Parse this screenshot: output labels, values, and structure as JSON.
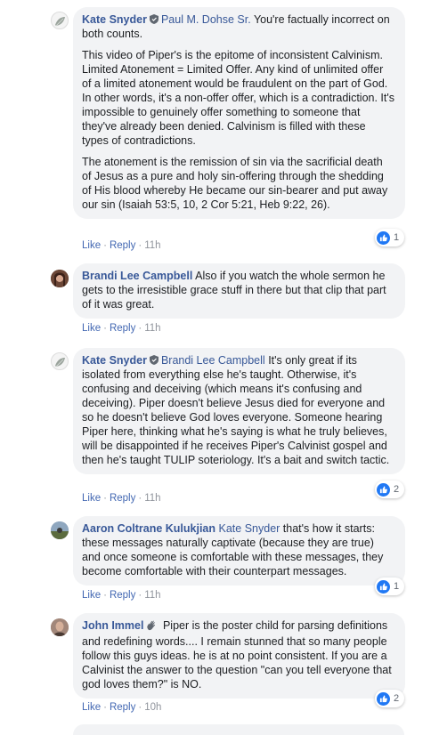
{
  "comments": [
    {
      "author": "Kate Snyder",
      "has_badge": true,
      "reply_to": "Paul M. Dohse Sr.",
      "paragraphs": [
        "You're factually incorrect on both counts.",
        "This video of Piper's is the epitome of inconsistent Calvinism. Limited Atonement = Limited Offer. Any kind of unlimited offer of a limited atonement would be fraudulent on the part of God. In other words, it's a non-offer offer, which is a contradiction. It's impossible to genuinely offer something to someone that they've already been denied. Calvinism is filled with these types of contradictions.",
        "The atonement is the remission of sin via the sacrificial death of Jesus as a pure and holy sin-offering through the shedding of His blood whereby He became our sin-bearer and put away our sin (Isaiah 53:5, 10, 2 Cor 5:21, Heb 9:22, 26)."
      ],
      "like": "Like",
      "reply": "Reply",
      "time": "11h",
      "reaction_count": "1"
    },
    {
      "author": "Brandi Lee Campbell",
      "has_badge": false,
      "reply_to": "",
      "paragraphs": [
        "Also if you watch the whole sermon he gets to the irresistible grace stuff in there but that clip that part of it was great."
      ],
      "like": "Like",
      "reply": "Reply",
      "time": "11h",
      "reaction_count": ""
    },
    {
      "author": "Kate Snyder",
      "has_badge": true,
      "reply_to": "Brandi Lee Campbell",
      "paragraphs": [
        "It's only great if its isolated from everything else he's taught. Otherwise, it's confusing and deceiving (which means it's confusing and deceiving). Piper doesn't believe Jesus died for everyone and so he doesn't believe God loves everyone. Someone hearing Piper here, thinking what he's saying is what he truly believes, will be disappointed if he receives Piper's Calvinist gospel and then he's taught TULIP soteriology. It's a bait and switch tactic."
      ],
      "like": "Like",
      "reply": "Reply",
      "time": "11h",
      "reaction_count": "2"
    },
    {
      "author": "Aaron Coltrane Kulukjian",
      "has_badge": false,
      "reply_to": "Kate Snyder",
      "paragraphs": [
        "that's how it starts: these messages naturally captivate (because they are true) and once someone is comfortable with these messages, they become comfortable with their counterpart messages."
      ],
      "like": "Like",
      "reply": "Reply",
      "time": "11h",
      "reaction_count": "1"
    },
    {
      "author": "John Immel",
      "has_badge": false,
      "reply_to": "",
      "paragraphs": [
        "Piper is the poster child for parsing definitions and redefining words.... I remain stunned that so many people follow this guys ideas. he is at no point consistent. If you are a Calvinist the answer to the question \"can you tell everyone that god loves them?\" is NO."
      ],
      "like": "Like",
      "reply": "Reply",
      "time": "10h",
      "reaction_count": "2"
    }
  ],
  "colors": {
    "link": "#385898",
    "action_link": "#4267b2",
    "bubble": "#f2f3f5",
    "like_blue": "#2078f4",
    "meta_gray": "#90949c"
  },
  "icons": {
    "badge": "shield-badge-icon",
    "hand": "waving-hand-icon",
    "reaction": "thumbs-up-icon"
  }
}
